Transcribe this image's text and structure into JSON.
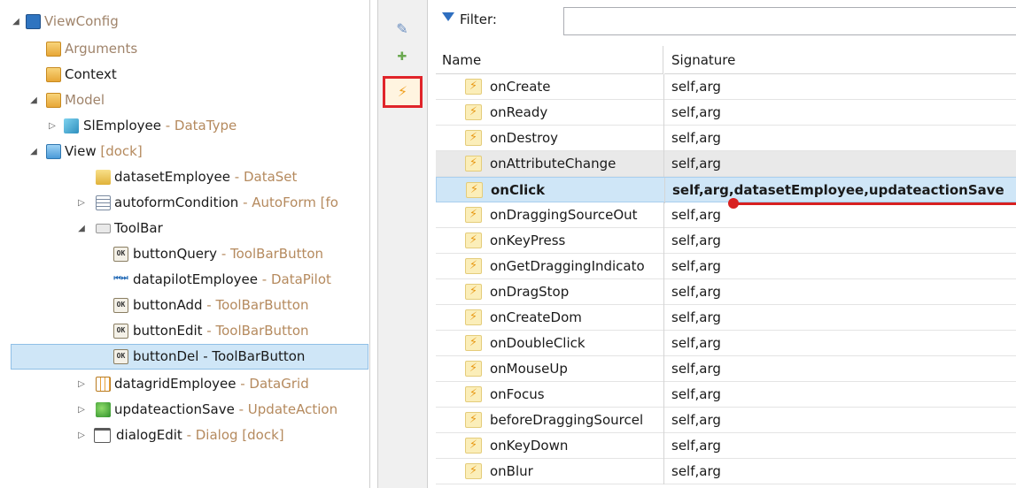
{
  "tree": {
    "root": {
      "label": "ViewConfig",
      "icon": "view-config-icon"
    },
    "nodes": [
      {
        "label": "Arguments",
        "type": "",
        "icon": "arguments-folder-icon"
      },
      {
        "label": "Context",
        "type": "",
        "icon": "context-folder-icon"
      },
      {
        "label": "Model",
        "type": "",
        "icon": "model-folder-icon"
      },
      {
        "label": "SlEmployee",
        "type": " - DataType",
        "icon": "datatype-cube-icon"
      },
      {
        "label": "View",
        "type": " [dock]",
        "icon": "view-folder-icon"
      },
      {
        "label": "datasetEmployee",
        "type": " - DataSet",
        "icon": "dataset-icon"
      },
      {
        "label": "autoformCondition",
        "type": " - AutoForm [fo",
        "icon": "autoform-icon"
      },
      {
        "label": "ToolBar",
        "type": "",
        "icon": "toolbar-icon"
      },
      {
        "label": "buttonQuery",
        "type": " - ToolBarButton",
        "icon": "ok-button-icon"
      },
      {
        "label": "datapilotEmployee",
        "type": " - DataPilot",
        "icon": "datapilot-icon"
      },
      {
        "label": "buttonAdd",
        "type": " - ToolBarButton",
        "icon": "ok-button-icon"
      },
      {
        "label": "buttonEdit",
        "type": " - ToolBarButton",
        "icon": "ok-button-icon"
      },
      {
        "label": "buttonDel",
        "type": " - ToolBarButton",
        "icon": "ok-button-icon"
      },
      {
        "label": "datagridEmployee",
        "type": " - DataGrid",
        "icon": "datagrid-icon"
      },
      {
        "label": "updateactionSave",
        "type": " - UpdateAction",
        "icon": "updateaction-icon"
      },
      {
        "label": "dialogEdit",
        "type": " - Dialog [dock]",
        "icon": "dialog-icon"
      }
    ]
  },
  "toolbar": {
    "buttons": [
      {
        "name": "properties-button",
        "icon": "edit-properties-icon",
        "glyph": "✎"
      },
      {
        "name": "pin-button",
        "icon": "pin-icon",
        "glyph": "📌"
      },
      {
        "name": "events-button",
        "icon": "lightning-icon",
        "glyph": "⚡"
      }
    ]
  },
  "filter": {
    "label": "Filter:",
    "value": "",
    "placeholder": ""
  },
  "events_table": {
    "columns": [
      "Name",
      "Signature"
    ],
    "rows": [
      {
        "name": "onCreate",
        "signature": "self,arg"
      },
      {
        "name": "onReady",
        "signature": "self,arg"
      },
      {
        "name": "onDestroy",
        "signature": "self,arg"
      },
      {
        "name": "onAttributeChange",
        "signature": "self,arg"
      },
      {
        "name": "onClick",
        "signature": "self,arg,datasetEmployee,updateactionSave"
      },
      {
        "name": "onDraggingSourceOut",
        "signature": "self,arg"
      },
      {
        "name": "onKeyPress",
        "signature": "self,arg"
      },
      {
        "name": "onGetDraggingIndicato",
        "signature": "self,arg"
      },
      {
        "name": "onDragStop",
        "signature": "self,arg"
      },
      {
        "name": "onCreateDom",
        "signature": "self,arg"
      },
      {
        "name": "onDoubleClick",
        "signature": "self,arg"
      },
      {
        "name": "onMouseUp",
        "signature": "self,arg"
      },
      {
        "name": "onFocus",
        "signature": "self,arg"
      },
      {
        "name": "beforeDraggingSourcel",
        "signature": "self,arg"
      },
      {
        "name": "onKeyDown",
        "signature": "self,arg"
      },
      {
        "name": "onBlur",
        "signature": "self,arg"
      }
    ],
    "hovered_row": "onAttributeChange",
    "selected_row": "onClick"
  },
  "colors": {
    "accent": "#e0242a",
    "selection": "#cfe6f7",
    "type_text": "#b58a5e"
  }
}
